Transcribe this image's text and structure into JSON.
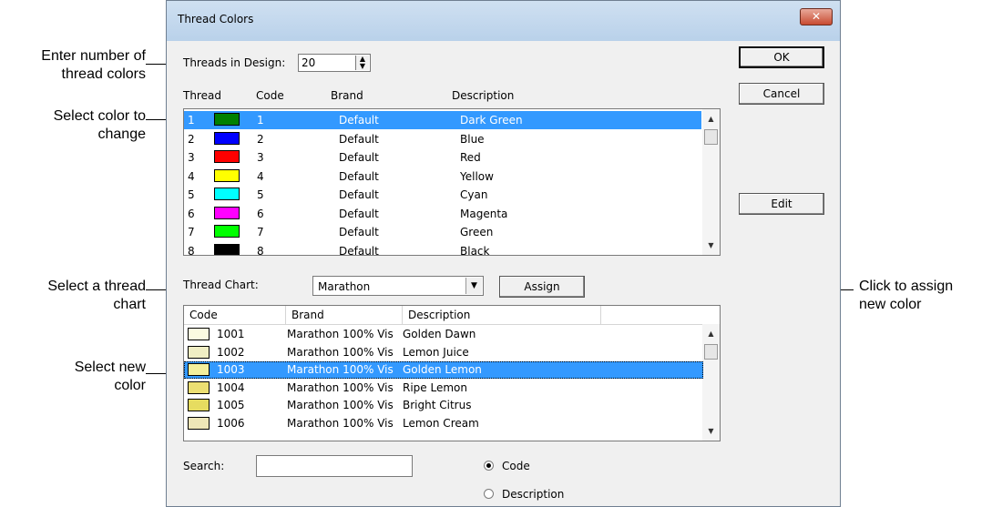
{
  "annotations": {
    "threads_count": [
      "Enter number of",
      "thread colors"
    ],
    "select_color": [
      "Select color to",
      "change"
    ],
    "select_chart": [
      "Select a thread",
      "chart"
    ],
    "select_new": [
      "Select new",
      "color"
    ],
    "assign": [
      "Click to assign",
      "new color"
    ]
  },
  "dialog": {
    "title": "Thread Colors",
    "close_glyph": "✕",
    "threads_label": "Threads in Design:",
    "threads_value": "20",
    "ok": "OK",
    "cancel": "Cancel",
    "edit": "Edit",
    "assign": "Assign",
    "thread_chart_label": "Thread Chart:",
    "thread_chart_value": "Marathon",
    "search_label": "Search:",
    "search_value": "",
    "radio_code": "Code",
    "radio_description": "Description",
    "radio_selected": "Code"
  },
  "design_threads": {
    "columns": [
      "Thread",
      "Code",
      "Brand",
      "Description"
    ],
    "rows": [
      {
        "thread": "1",
        "code": "1",
        "brand": "Default",
        "description": "Dark Green",
        "color": "#008000",
        "selected": true
      },
      {
        "thread": "2",
        "code": "2",
        "brand": "Default",
        "description": "Blue",
        "color": "#0000ff"
      },
      {
        "thread": "3",
        "code": "3",
        "brand": "Default",
        "description": "Red",
        "color": "#ff0000"
      },
      {
        "thread": "4",
        "code": "4",
        "brand": "Default",
        "description": "Yellow",
        "color": "#ffff00"
      },
      {
        "thread": "5",
        "code": "5",
        "brand": "Default",
        "description": "Cyan",
        "color": "#00ffff"
      },
      {
        "thread": "6",
        "code": "6",
        "brand": "Default",
        "description": "Magenta",
        "color": "#ff00ff"
      },
      {
        "thread": "7",
        "code": "7",
        "brand": "Default",
        "description": "Green",
        "color": "#00ff00"
      },
      {
        "thread": "8",
        "code": "8",
        "brand": "Default",
        "description": "Black",
        "color": "#000000"
      }
    ]
  },
  "chart_threads": {
    "columns": [
      "Code",
      "Brand",
      "Description"
    ],
    "rows": [
      {
        "code": "1001",
        "brand": "Marathon 100% Vis",
        "description": "Golden Dawn",
        "color": "#fbfbe0"
      },
      {
        "code": "1002",
        "brand": "Marathon 100% Vis",
        "description": "Lemon Juice",
        "color": "#f0eec4"
      },
      {
        "code": "1003",
        "brand": "Marathon 100% Vis",
        "description": "Golden Lemon",
        "color": "#f3ef9c",
        "selected": true
      },
      {
        "code": "1004",
        "brand": "Marathon 100% Vis",
        "description": "Ripe Lemon",
        "color": "#ecdf72"
      },
      {
        "code": "1005",
        "brand": "Marathon 100% Vis",
        "description": "Bright Citrus",
        "color": "#e6dc60"
      },
      {
        "code": "1006",
        "brand": "Marathon 100% Vis",
        "description": "Lemon Cream",
        "color": "#eee6b8"
      }
    ]
  }
}
